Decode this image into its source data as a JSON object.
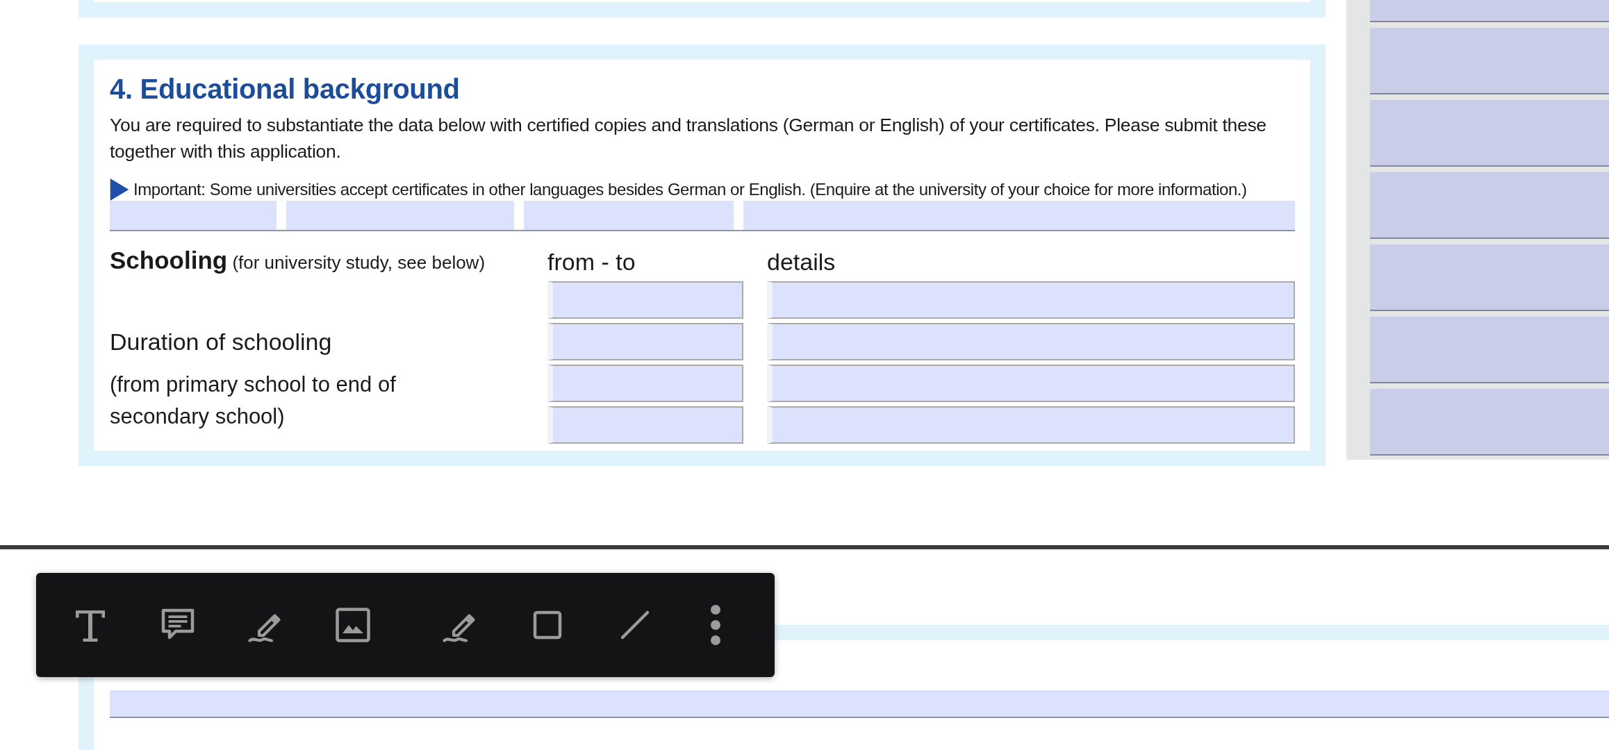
{
  "section": {
    "title": "4. Educational background",
    "intro": "You are required to substantiate the data below with certified copies and translations (German or English) of your certificates. Please submit these together with this application.",
    "important": "Important: Some universities accept certificates in other languages besides German or English. (Enquire at the university of your choice for more information.)",
    "schooling": {
      "label": "Schooling",
      "note": "(for university study, see below)",
      "columns": [
        "from - to",
        "details"
      ],
      "duration_label": "Duration of schooling",
      "duration_note": "(from primary school to end of secondary school)"
    }
  },
  "toolbar": {
    "tools": [
      {
        "kind": "text"
      },
      {
        "kind": "comment"
      },
      {
        "kind": "draw"
      },
      {
        "kind": "image"
      },
      {
        "kind": "highlight"
      },
      {
        "kind": "rectangle"
      },
      {
        "kind": "line"
      },
      {
        "kind": "more"
      }
    ]
  }
}
